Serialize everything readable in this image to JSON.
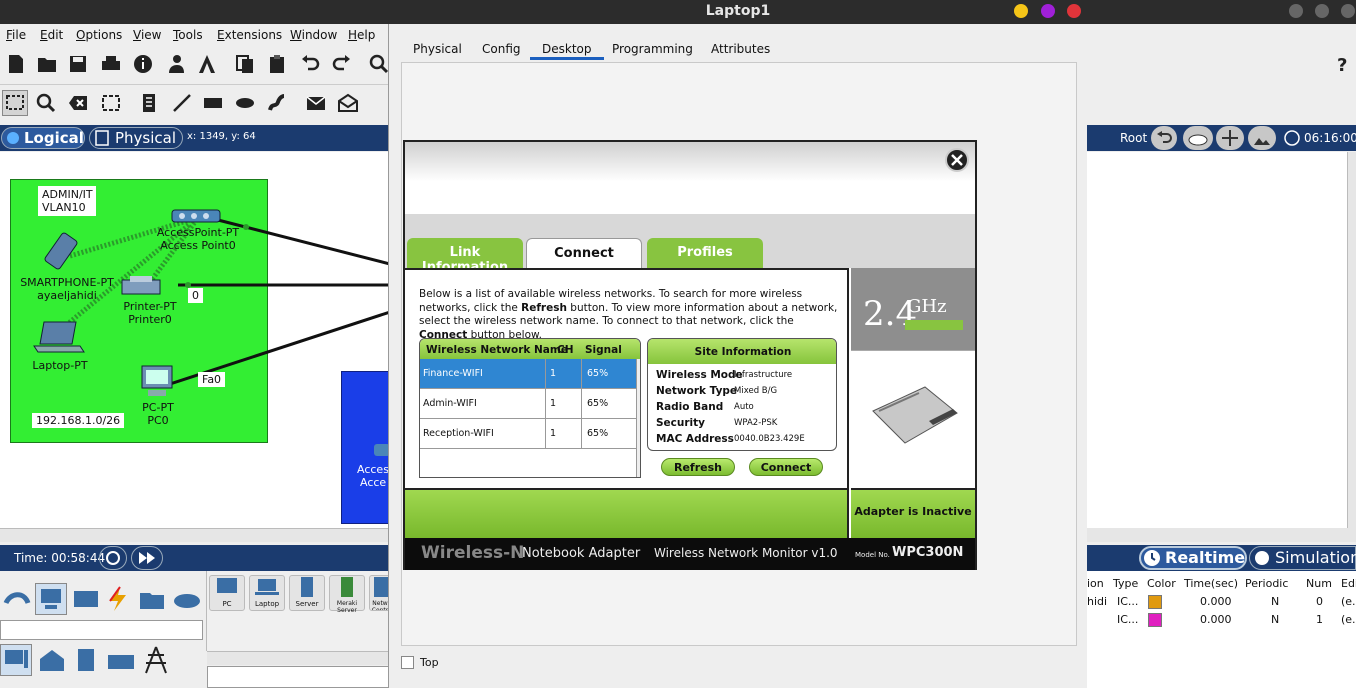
{
  "window_title": "Laptop1",
  "menu": [
    "File",
    "Edit",
    "Options",
    "View",
    "Tools",
    "Extensions",
    "Window",
    "Help"
  ],
  "logical_bar": {
    "logical_label": "Logical",
    "physical_label": "Physical",
    "coords": "x: 1349, y: 64",
    "root_label": "Root",
    "clock": "06:16:00"
  },
  "topology": {
    "vlan_label_line1": "ADMIN/IT",
    "vlan_label_line2": "VLAN10",
    "subnet_label": "192.168.1.0/26",
    "devices": [
      {
        "type": "AccessPoint-PT",
        "name": "Access Point0"
      },
      {
        "type": "SMARTPHONE-PT",
        "name": "ayaeljahidi"
      },
      {
        "type": "Printer-PT",
        "name": "Printer0"
      },
      {
        "type": "Laptop-PT",
        "name": ""
      },
      {
        "type": "PC-PT",
        "name": "PC0"
      }
    ],
    "port_printer": "0",
    "port_pc": "Fa0",
    "partial_label_1": "Acces",
    "partial_label_2": "Acce"
  },
  "bottom": {
    "time_label": "Time: 00:58:44",
    "realtime_label": "Realtime",
    "simulation_label": "Simulation",
    "device_dock": [
      "PC",
      "Laptop",
      "Server",
      "Meraki Server",
      "Netw Contr"
    ]
  },
  "event_table": {
    "headers": [
      "ion",
      "Type",
      "Color",
      "Time(sec)",
      "Periodic",
      "Num",
      "Edi"
    ],
    "rows": [
      {
        "source": "hidi",
        "type": "IC...",
        "color": "#e09a10",
        "time": "0.000",
        "periodic": "N",
        "num": "0",
        "edit": "(e..."
      },
      {
        "source": "",
        "type": "IC...",
        "color": "#e020c0",
        "time": "0.000",
        "periodic": "N",
        "num": "1",
        "edit": "(e..."
      }
    ]
  },
  "laptop_tabs": [
    "Physical",
    "Config",
    "Desktop",
    "Programming",
    "Attributes"
  ],
  "laptop_active_tab": "Desktop",
  "top_checkbox_label": "Top",
  "wireless_monitor": {
    "tabs": [
      "Link Information",
      "Connect",
      "Profiles"
    ],
    "active_tab": "Connect",
    "desc_part1": "Below is a list of available wireless networks. To search for more wireless networks, click the ",
    "desc_refresh": "Refresh",
    "desc_part2": " button. To view more information about a network, select the wireless network name. To connect to that network, click the ",
    "desc_connect": "Connect",
    "desc_part3": " button below.",
    "table_headers": {
      "name": "Wireless Network Name",
      "ch": "CH",
      "signal": "Signal"
    },
    "networks": [
      {
        "name": "Finance-WIFI",
        "ch": "1",
        "signal": "65%",
        "selected": true
      },
      {
        "name": "Admin-WIFI",
        "ch": "1",
        "signal": "65%",
        "selected": false
      },
      {
        "name": "Reception-WIFI",
        "ch": "1",
        "signal": "65%",
        "selected": false
      }
    ],
    "site_info": {
      "title": "Site Information",
      "rows": [
        {
          "key": "Wireless Mode",
          "value": "Infrastructure"
        },
        {
          "key": "Network Type",
          "value": "Mixed B/G"
        },
        {
          "key": "Radio Band",
          "value": "Auto"
        },
        {
          "key": "Security",
          "value": "WPA2-PSK"
        },
        {
          "key": "MAC Address",
          "value": "0040.0B23.429E"
        }
      ]
    },
    "refresh_button": "Refresh",
    "connect_button": "Connect",
    "band_label": "2.4",
    "band_unit": "GHz",
    "adapter_status": "Adapter is Inactive",
    "footer_brand": "Wireless-N",
    "footer_adapter": "Notebook Adapter",
    "footer_monitor": "Wireless Network Monitor  v1.0",
    "footer_model_prefix": "Model No.",
    "footer_model": "WPC300N"
  }
}
